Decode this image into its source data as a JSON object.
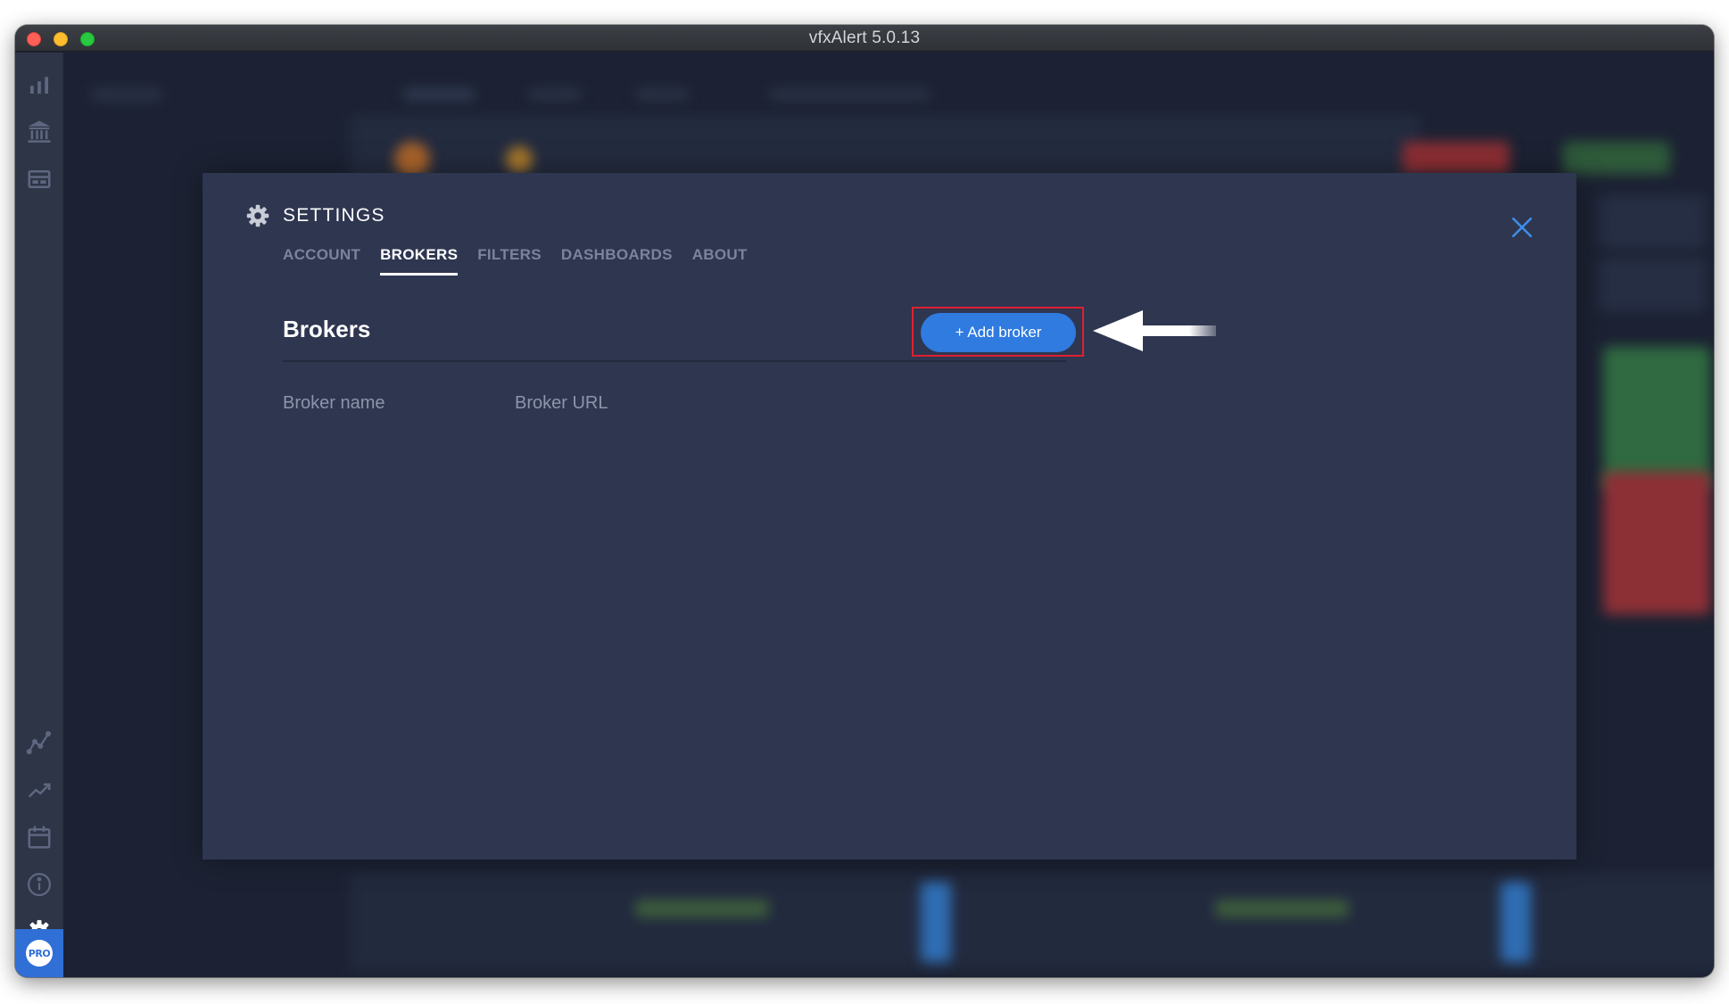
{
  "window": {
    "title": "vfxAlert 5.0.13"
  },
  "sidebar": {
    "icons": [
      "bar-chart-icon",
      "bank-icon",
      "dashboard-icon",
      "line-chart-icon",
      "trending-up-icon",
      "calendar-icon",
      "info-icon",
      "gear-icon"
    ],
    "pro_label": "PRO"
  },
  "settings": {
    "title": "SETTINGS",
    "tabs": [
      {
        "label": "ACCOUNT",
        "active": false
      },
      {
        "label": "BROKERS",
        "active": true
      },
      {
        "label": "FILTERS",
        "active": false
      },
      {
        "label": "DASHBOARDS",
        "active": false
      },
      {
        "label": "ABOUT",
        "active": false
      }
    ],
    "section_title": "Brokers",
    "add_button_label": "+ Add broker",
    "columns": {
      "name": "Broker name",
      "url": "Broker URL"
    }
  },
  "colors": {
    "modal_bg": "#2e3650",
    "accent_blue": "#2f7be0",
    "highlight_red": "#e01f2f",
    "close_blue": "#3d8ee8"
  }
}
